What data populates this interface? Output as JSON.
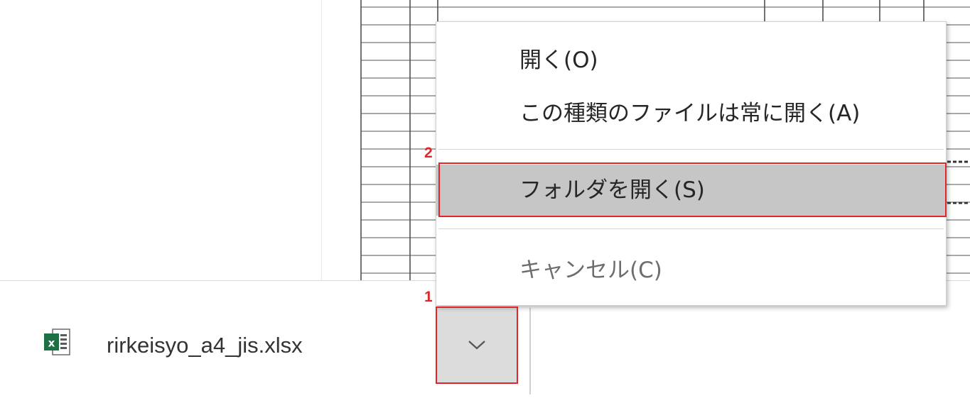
{
  "download_bar": {
    "file_icon": "excel-file-icon",
    "file_name": "rirkeisyo_a4_jis.xlsx",
    "menu_button_icon": "chevron-down-icon"
  },
  "context_menu": {
    "open": "開く(O)",
    "always_open": "この種類のファイルは常に開く(A)",
    "show_in_folder": "フォルダを開く(S)",
    "cancel": "キャンセル(C)"
  },
  "annotations": {
    "step1": "1",
    "step2": "2",
    "color": "#e0252b"
  },
  "colors": {
    "menu_highlight": "#c6c6c6",
    "chevron_button_bg": "#dcdcdc",
    "excel_green": "#1d7044"
  }
}
